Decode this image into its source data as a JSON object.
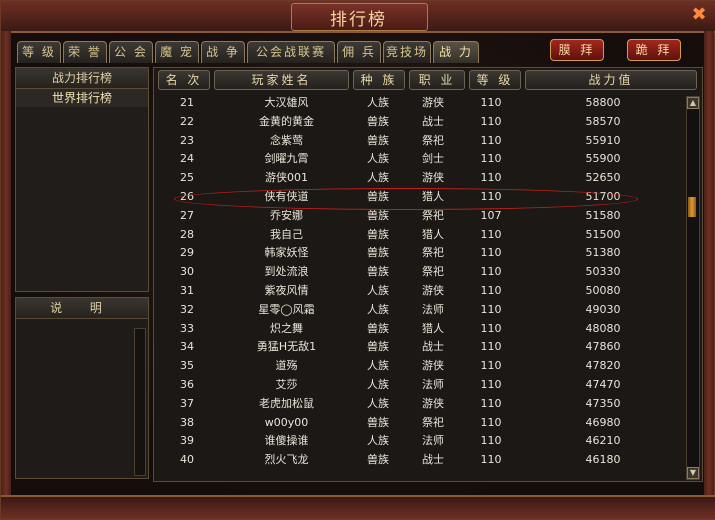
{
  "title": "排行榜",
  "tabs": [
    "等 级",
    "荣 誉",
    "公 会",
    "魔 宠",
    "战 争",
    "公会战联赛",
    "佣 兵",
    "竞技场",
    "战 力"
  ],
  "actions": {
    "worship": "膜 拜",
    "spurn": "跪 拜"
  },
  "left_panel": {
    "header": "战力排行榜",
    "item": "世界排行榜"
  },
  "desc_panel": {
    "header": "说 明"
  },
  "columns": {
    "rank": "名 次",
    "name": "玩家姓名",
    "race": "种 族",
    "class": "职 业",
    "level": "等 级",
    "power": "战力值"
  },
  "rows": [
    {
      "rank": "21",
      "name": "大汉雄风",
      "race": "人族",
      "cls": "游侠",
      "lvl": "110",
      "power": "58800"
    },
    {
      "rank": "22",
      "name": "金黄的黄金",
      "race": "兽族",
      "cls": "战士",
      "lvl": "110",
      "power": "58570"
    },
    {
      "rank": "23",
      "name": "念紫莺",
      "race": "兽族",
      "cls": "祭祀",
      "lvl": "110",
      "power": "55910"
    },
    {
      "rank": "24",
      "name": "剑曜九霄",
      "race": "人族",
      "cls": "剑士",
      "lvl": "110",
      "power": "55900"
    },
    {
      "rank": "25",
      "name": "游侠001",
      "race": "人族",
      "cls": "游侠",
      "lvl": "110",
      "power": "52650"
    },
    {
      "rank": "26",
      "name": "侠有侠道",
      "race": "兽族",
      "cls": "猎人",
      "lvl": "110",
      "power": "51700"
    },
    {
      "rank": "27",
      "name": "乔安娜",
      "race": "兽族",
      "cls": "祭祀",
      "lvl": "107",
      "power": "51580"
    },
    {
      "rank": "28",
      "name": "我自己",
      "race": "兽族",
      "cls": "猎人",
      "lvl": "110",
      "power": "51500"
    },
    {
      "rank": "29",
      "name": "韩家妖怪",
      "race": "兽族",
      "cls": "祭祀",
      "lvl": "110",
      "power": "51380"
    },
    {
      "rank": "30",
      "name": "到处流浪",
      "race": "兽族",
      "cls": "祭祀",
      "lvl": "110",
      "power": "50330"
    },
    {
      "rank": "31",
      "name": "紫夜风情",
      "race": "人族",
      "cls": "游侠",
      "lvl": "110",
      "power": "50080"
    },
    {
      "rank": "32",
      "name": "星零◯风霜",
      "race": "人族",
      "cls": "法师",
      "lvl": "110",
      "power": "49030"
    },
    {
      "rank": "33",
      "name": "炽之舞",
      "race": "兽族",
      "cls": "猎人",
      "lvl": "110",
      "power": "48080"
    },
    {
      "rank": "34",
      "name": "勇猛H无敌1",
      "race": "兽族",
      "cls": "战士",
      "lvl": "110",
      "power": "47860"
    },
    {
      "rank": "35",
      "name": "道殇",
      "race": "人族",
      "cls": "游侠",
      "lvl": "110",
      "power": "47820"
    },
    {
      "rank": "36",
      "name": "艾莎",
      "race": "人族",
      "cls": "法师",
      "lvl": "110",
      "power": "47470"
    },
    {
      "rank": "37",
      "name": "老虎加松鼠",
      "race": "人族",
      "cls": "游侠",
      "lvl": "110",
      "power": "47350"
    },
    {
      "rank": "38",
      "name": "w00y00",
      "race": "兽族",
      "cls": "祭祀",
      "lvl": "110",
      "power": "46980"
    },
    {
      "rank": "39",
      "name": "谁傻操谁",
      "race": "人族",
      "cls": "法师",
      "lvl": "110",
      "power": "46210"
    },
    {
      "rank": "40",
      "name": "烈火飞龙",
      "race": "兽族",
      "cls": "战士",
      "lvl": "110",
      "power": "46180"
    }
  ]
}
